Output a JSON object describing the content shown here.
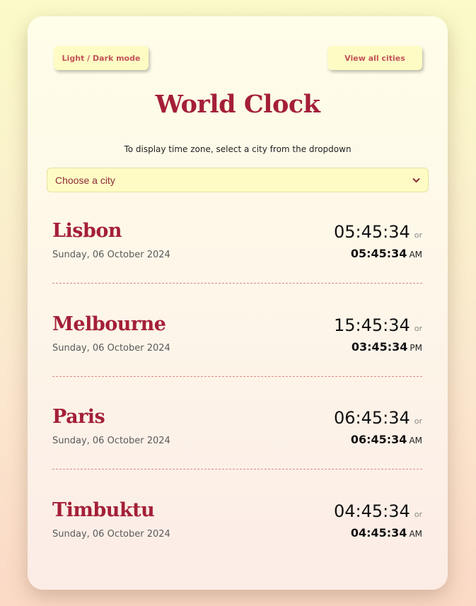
{
  "buttons": {
    "mode_label": "Light / Dark mode",
    "cities_label": "View all cities"
  },
  "title": "World Clock",
  "subtitle": "To display time zone, select a city from the dropdown",
  "select": {
    "value": "Choose a city"
  },
  "or_label": "or",
  "cities": [
    {
      "name": "Lisbon",
      "date": "Sunday, 06 October 2024",
      "time24": "05:45:34",
      "time12": "05:45:34",
      "ampm": "AM"
    },
    {
      "name": "Melbourne",
      "date": "Sunday, 06 October 2024",
      "time24": "15:45:34",
      "time12": "03:45:34",
      "ampm": "PM"
    },
    {
      "name": "Paris",
      "date": "Sunday, 06 October 2024",
      "time24": "06:45:34",
      "time12": "06:45:34",
      "ampm": "AM"
    },
    {
      "name": "Timbuktu",
      "date": "Sunday, 06 October 2024",
      "time24": "04:45:34",
      "time12": "04:45:34",
      "ampm": "AM"
    }
  ],
  "colors": {
    "accent": "#a41f38",
    "button_bg": "#fefcc4",
    "button_text": "#c2535a",
    "separator": "#d98a8a"
  }
}
